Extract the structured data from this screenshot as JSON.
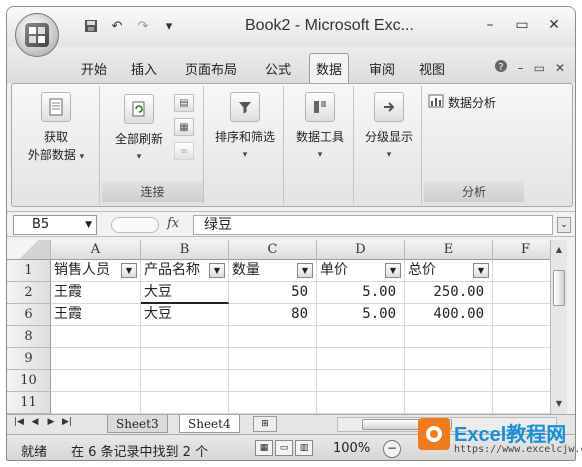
{
  "window": {
    "title": "Book2 - Microsoft Exc...",
    "office_logo": "Office",
    "controls": [
      "minimize-icon",
      "restore-icon",
      "close-icon"
    ]
  },
  "quick_access": [
    "save-icon",
    "undo-icon",
    "redo-icon",
    "customize-icon"
  ],
  "tabs": [
    {
      "label": "开始"
    },
    {
      "label": "插入"
    },
    {
      "label": "页面布局"
    },
    {
      "label": "公式"
    },
    {
      "label": "数据",
      "active": true
    },
    {
      "label": "审阅"
    },
    {
      "label": "视图"
    }
  ],
  "ribbon": {
    "get_external": {
      "line1": "获取",
      "line2": "外部数据"
    },
    "refresh_all": "全部刷新",
    "group_connection": "连接",
    "sort_filter": "排序和筛选",
    "data_tools": "数据工具",
    "outline": "分级显示",
    "data_analysis": "数据分析",
    "group_analysis": "分析"
  },
  "formula_bar": {
    "cell_ref": "B5",
    "fx": "fx",
    "content": "绿豆"
  },
  "grid": {
    "columns": [
      "A",
      "B",
      "C",
      "D",
      "E",
      "F"
    ],
    "row_numbers": [
      "1",
      "2",
      "6",
      "8",
      "9",
      "10",
      "11"
    ],
    "headers": [
      "销售人员",
      "产品名称",
      "数量",
      "单价",
      "总价"
    ],
    "rows": [
      [
        "王霞",
        "大豆",
        "50",
        "5.00",
        "250.00"
      ],
      [
        "王霞",
        "大豆",
        "80",
        "5.00",
        "400.00"
      ]
    ]
  },
  "sheets": {
    "tabs": [
      "Sheet3",
      "Sheet4"
    ],
    "active": "Sheet4"
  },
  "status": {
    "ready": "就绪",
    "message": "在 6 条记录中找到 2 个",
    "zoom": "100%"
  },
  "watermark": {
    "title": "Excel教程网",
    "url": "https://www.excelcjw.com"
  },
  "colors": {
    "accent": "#1a8fd6",
    "watermark_orange": "#f07b1d"
  }
}
